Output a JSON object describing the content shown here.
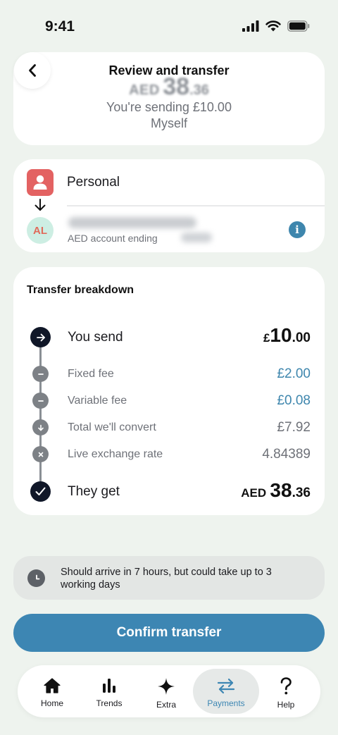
{
  "status_bar": {
    "time": "9:41"
  },
  "header": {
    "title": "Review and transfer"
  },
  "hero": {
    "amount_currency": "AED",
    "amount_whole": "38",
    "amount_decimal": ".36",
    "sending_text": "You're sending £10.00",
    "recipient": "Myself"
  },
  "accounts": {
    "from_label": "Personal",
    "to_initials": "AL",
    "to_subtitle": "AED account ending"
  },
  "breakdown": {
    "title": "Transfer breakdown",
    "you_send": {
      "label": "You send",
      "currency": "£",
      "whole": "10",
      "decimal": ".00"
    },
    "fixed_fee": {
      "label": "Fixed fee",
      "value": "£2.00"
    },
    "variable_fee": {
      "label": "Variable fee",
      "value": "£0.08"
    },
    "total_convert": {
      "label": "Total we'll convert",
      "value": "£7.92"
    },
    "exchange_rate": {
      "label": "Live exchange rate",
      "value": "4.84389"
    },
    "they_get": {
      "label": "They get",
      "currency": "AED",
      "whole": "38",
      "decimal": ".36"
    }
  },
  "eta": {
    "text": "Should arrive in 7 hours, but could take up to 3 working days"
  },
  "confirm_button": {
    "label": "Confirm transfer"
  },
  "tab_bar": {
    "home": "Home",
    "trends": "Trends",
    "extra": "Extra",
    "payments": "Payments",
    "help": "Help"
  },
  "colors": {
    "accent": "#3d86b3",
    "background": "#eef3ee",
    "fee_teal": "#3e86ad",
    "from_icon": "#e36262",
    "avatar_bg": "#cdeee3"
  }
}
